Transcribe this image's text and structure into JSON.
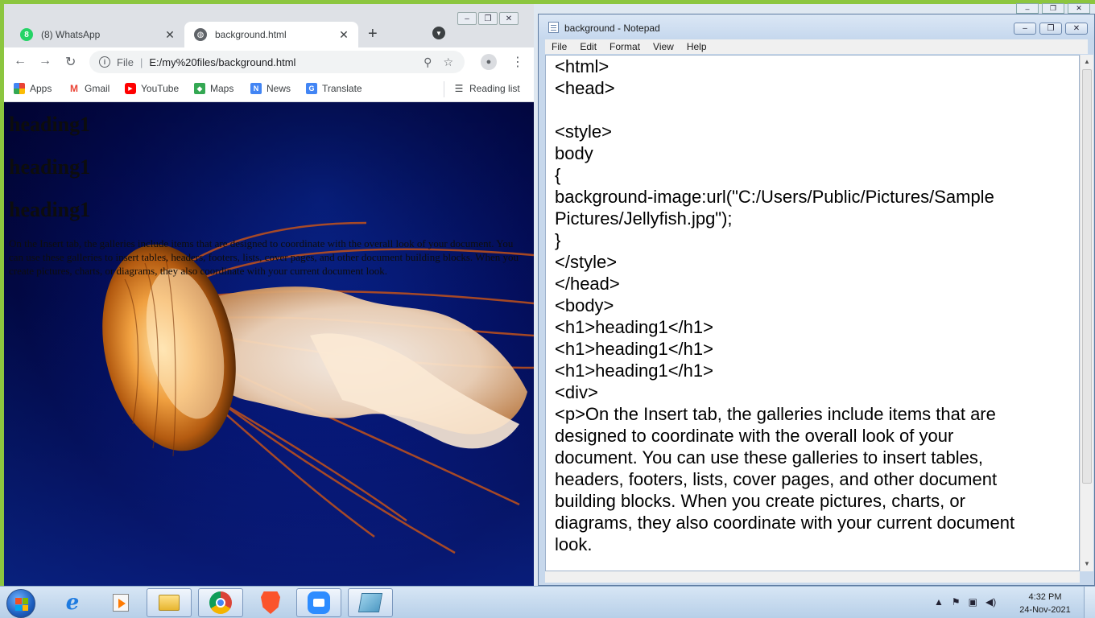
{
  "colors": {
    "frame": "#8cc63f",
    "whatsapp": "#25d366",
    "gmail": "#ea4335",
    "youtube": "#ff0000"
  },
  "outer_window_controls": [
    "–",
    "❐",
    "✕"
  ],
  "chrome": {
    "window_controls": [
      "–",
      "❐",
      "✕"
    ],
    "tabs": [
      {
        "title": "(8) WhatsApp",
        "icon": "whatsapp-icon",
        "badge": "8",
        "active": false
      },
      {
        "title": "background.html",
        "icon": "globe-icon",
        "active": true
      }
    ],
    "close_glyph": "✕",
    "new_tab_glyph": "+",
    "tab_search_glyph": "▼",
    "nav": {
      "back": "←",
      "forward": "→",
      "reload": "↻"
    },
    "omnibox": {
      "info_glyph": "i",
      "scheme": "File",
      "separator": "|",
      "url": "E:/my%20files/background.html",
      "zoom_glyph": "⚲",
      "star_glyph": "☆"
    },
    "profile_glyph": "●",
    "menu_glyph": "⋮",
    "bookmarks": [
      {
        "label": "Apps",
        "icon": "apps-grid-icon"
      },
      {
        "label": "Gmail",
        "icon": "gmail-icon",
        "glyph": "M"
      },
      {
        "label": "YouTube",
        "icon": "youtube-icon",
        "glyph": "▶"
      },
      {
        "label": "Maps",
        "icon": "maps-icon",
        "glyph": "◆"
      },
      {
        "label": "News",
        "icon": "news-icon",
        "glyph": "N"
      },
      {
        "label": "Translate",
        "icon": "translate-icon",
        "glyph": "G"
      },
      {
        "label": "Reading list",
        "icon": "reading-list-icon",
        "glyph": "☰"
      }
    ],
    "page": {
      "headings": [
        "heading1",
        "heading1",
        "heading1"
      ],
      "paragraph": "On the Insert tab, the galleries include items that are designed to coordinate with the overall look of your document. You can use these galleries to insert tables, headers, footers, lists, cover pages, and other document building blocks. When you create pictures, charts, or diagrams, they also coordinate with your current document look."
    }
  },
  "notepad": {
    "title": "background - Notepad",
    "window_controls": [
      "–",
      "❐",
      "✕"
    ],
    "menu": [
      "File",
      "Edit",
      "Format",
      "View",
      "Help"
    ],
    "lines": [
      "<html>",
      "<head>",
      "",
      "<style>",
      "body",
      "{",
      "background-image:url(\"C:/Users/Public/Pictures/Sample",
      "Pictures/Jellyfish.jpg\");",
      "}",
      "</style>",
      "</head>",
      "<body>",
      "<h1>heading1</h1>",
      "<h1>heading1</h1>",
      "<h1>heading1</h1>",
      "<div>",
      "<p>On the Insert tab, the galleries include items that are",
      "designed to coordinate with the overall look of your",
      "document. You can use these galleries to insert tables,",
      "headers, footers, lists, cover pages, and other document",
      "building blocks. When you create pictures, charts, or",
      "diagrams, they also coordinate with your current document",
      "look."
    ],
    "scroll_up": "▲",
    "scroll_down": "▼"
  },
  "taskbar": {
    "apps": [
      "start-button",
      "internet-explorer",
      "media-player",
      "file-explorer",
      "chrome",
      "brave",
      "zoom",
      "notepad"
    ],
    "tray": {
      "expand": "▲",
      "flag": "⚑",
      "network": "▣",
      "volume": "◀)"
    },
    "clock": {
      "time": "4:32 PM",
      "date": "24-Nov-2021"
    }
  }
}
